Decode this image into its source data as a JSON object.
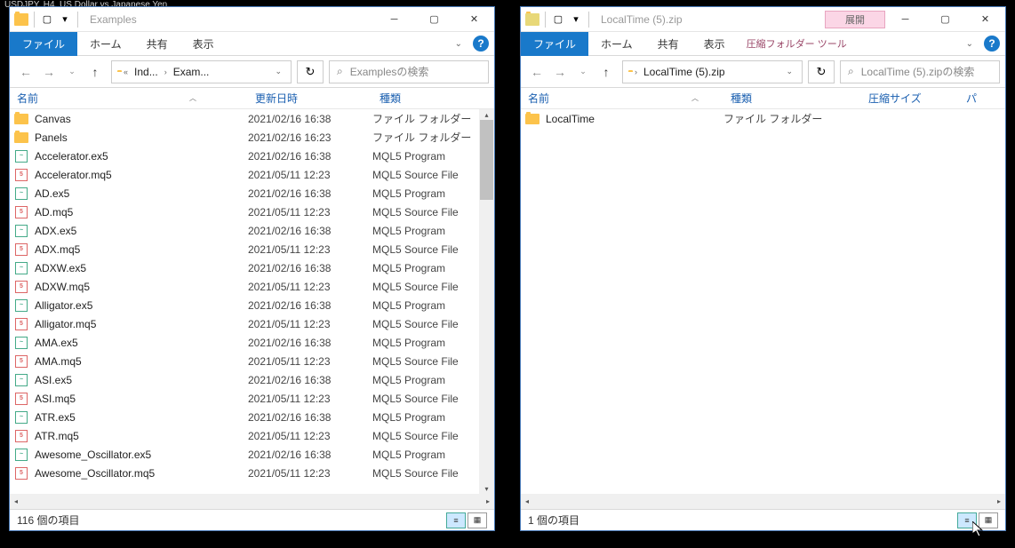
{
  "bg_title": "USDJPY, H4, US Dollar vs Japanese Yen",
  "window_left": {
    "title": "Examples",
    "ribbon": {
      "file": "ファイル",
      "home": "ホーム",
      "share": "共有",
      "view": "表示"
    },
    "breadcrumbs": [
      "Ind...",
      "Exam..."
    ],
    "search_placeholder": "Examplesの検索",
    "columns": {
      "name": "名前",
      "date": "更新日時",
      "type": "種類"
    },
    "files": [
      {
        "name": "Canvas",
        "date": "2021/02/16 16:38",
        "type": "ファイル フォルダー",
        "icon": "folder"
      },
      {
        "name": "Panels",
        "date": "2021/02/16 16:23",
        "type": "ファイル フォルダー",
        "icon": "folder"
      },
      {
        "name": "Accelerator.ex5",
        "date": "2021/02/16 16:38",
        "type": "MQL5 Program",
        "icon": "ex5"
      },
      {
        "name": "Accelerator.mq5",
        "date": "2021/05/11 12:23",
        "type": "MQL5 Source File",
        "icon": "mq5"
      },
      {
        "name": "AD.ex5",
        "date": "2021/02/16 16:38",
        "type": "MQL5 Program",
        "icon": "ex5"
      },
      {
        "name": "AD.mq5",
        "date": "2021/05/11 12:23",
        "type": "MQL5 Source File",
        "icon": "mq5"
      },
      {
        "name": "ADX.ex5",
        "date": "2021/02/16 16:38",
        "type": "MQL5 Program",
        "icon": "ex5"
      },
      {
        "name": "ADX.mq5",
        "date": "2021/05/11 12:23",
        "type": "MQL5 Source File",
        "icon": "mq5"
      },
      {
        "name": "ADXW.ex5",
        "date": "2021/02/16 16:38",
        "type": "MQL5 Program",
        "icon": "ex5"
      },
      {
        "name": "ADXW.mq5",
        "date": "2021/05/11 12:23",
        "type": "MQL5 Source File",
        "icon": "mq5"
      },
      {
        "name": "Alligator.ex5",
        "date": "2021/02/16 16:38",
        "type": "MQL5 Program",
        "icon": "ex5"
      },
      {
        "name": "Alligator.mq5",
        "date": "2021/05/11 12:23",
        "type": "MQL5 Source File",
        "icon": "mq5"
      },
      {
        "name": "AMA.ex5",
        "date": "2021/02/16 16:38",
        "type": "MQL5 Program",
        "icon": "ex5"
      },
      {
        "name": "AMA.mq5",
        "date": "2021/05/11 12:23",
        "type": "MQL5 Source File",
        "icon": "mq5"
      },
      {
        "name": "ASI.ex5",
        "date": "2021/02/16 16:38",
        "type": "MQL5 Program",
        "icon": "ex5"
      },
      {
        "name": "ASI.mq5",
        "date": "2021/05/11 12:23",
        "type": "MQL5 Source File",
        "icon": "mq5"
      },
      {
        "name": "ATR.ex5",
        "date": "2021/02/16 16:38",
        "type": "MQL5 Program",
        "icon": "ex5"
      },
      {
        "name": "ATR.mq5",
        "date": "2021/05/11 12:23",
        "type": "MQL5 Source File",
        "icon": "mq5"
      },
      {
        "name": "Awesome_Oscillator.ex5",
        "date": "2021/02/16 16:38",
        "type": "MQL5 Program",
        "icon": "ex5"
      },
      {
        "name": "Awesome_Oscillator.mq5",
        "date": "2021/05/11 12:23",
        "type": "MQL5 Source File",
        "icon": "mq5"
      }
    ],
    "status": "116 個の項目"
  },
  "window_right": {
    "title": "LocalTime (5).zip",
    "extend_label": "展開",
    "tool_tab": "圧縮フォルダー ツール",
    "ribbon": {
      "file": "ファイル",
      "home": "ホーム",
      "share": "共有",
      "view": "表示"
    },
    "breadcrumb": "LocalTime (5).zip",
    "search_placeholder": "LocalTime (5).zipの検索",
    "columns": {
      "name": "名前",
      "type": "種類",
      "size": "圧縮サイズ",
      "pass": "パ"
    },
    "files": [
      {
        "name": "LocalTime",
        "type": "ファイル フォルダー",
        "icon": "folder"
      }
    ],
    "status": "1 個の項目"
  }
}
